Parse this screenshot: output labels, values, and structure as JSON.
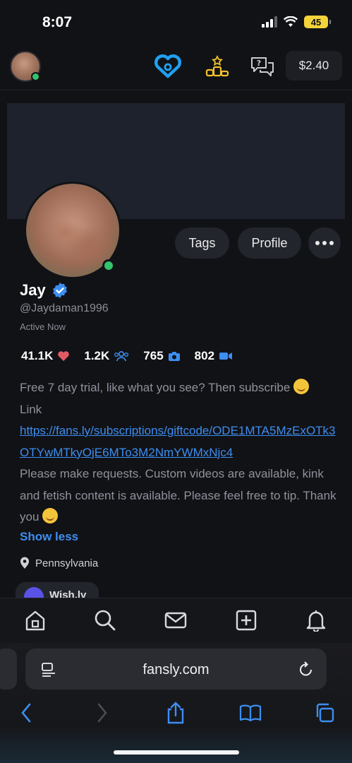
{
  "status_bar": {
    "time": "8:07",
    "battery": "45"
  },
  "header": {
    "balance": "$2.40"
  },
  "profile": {
    "name": "Jay",
    "handle": "@Jaydaman1996",
    "active_status": "Active Now",
    "buttons": {
      "tags": "Tags",
      "profile": "Profile"
    },
    "stats": {
      "likes": "41.1K",
      "subscribers": "1.2K",
      "photos": "765",
      "videos": "802"
    },
    "bio": {
      "line1": "Free 7 day trial, like what you see? Then subscribe ",
      "link_label": "Link",
      "link_url": "https://fans.ly/subscriptions/giftcode/ODE1MTA5MzExOTk3OTYwMTkyOjE6MTo3M2NmYWMxNjc4",
      "line2": " Please make requests. Custom videos are available, kink and fetish content is available. Please feel free to tip. Thank you "
    },
    "show_less": "Show less",
    "location": "Pennsylvania",
    "wishlist": "Wish.ly"
  },
  "browser": {
    "url": "fansly.com"
  },
  "colors": {
    "accent": "#3d8ef0",
    "online": "#33c36a",
    "gold": "#f2c12e",
    "heart": "#e05a63"
  }
}
